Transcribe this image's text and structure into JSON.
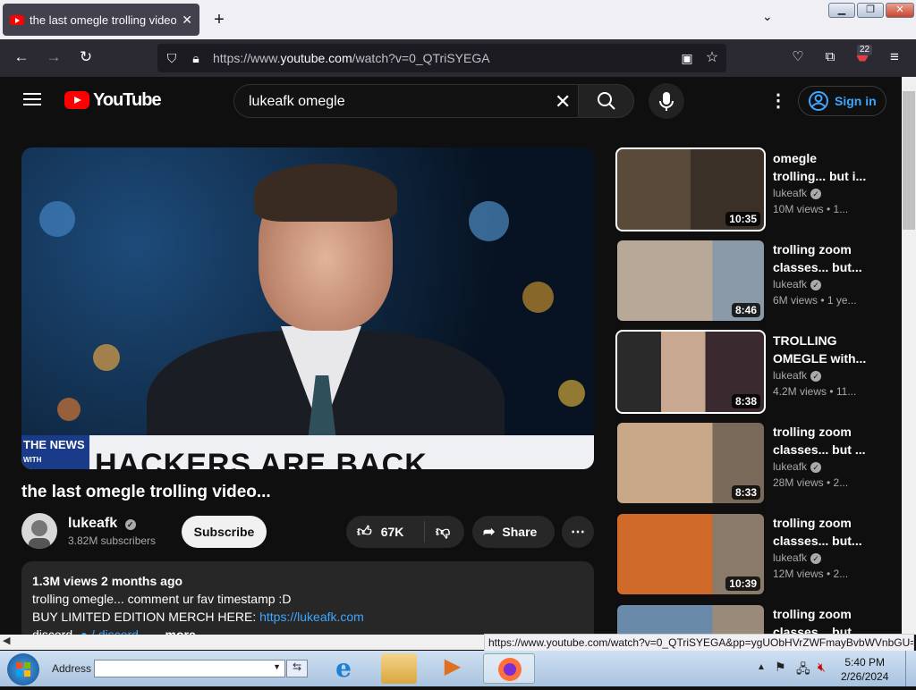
{
  "browser": {
    "tab_title": "the last omegle trolling video...",
    "new_tab": "+",
    "url_prefix": "https://www.",
    "url_domain": "youtube.com",
    "url_path": "/watch?v=0_QTriSYEGA",
    "ext_badge": "22",
    "status_url": "https://www.youtube.com/watch?v=0_QTriSYEGA&pp=ygUObHVrZWFmayBvbWVnbGU="
  },
  "youtube": {
    "logo_text": "YouTube",
    "search_value": "lukeafk omegle",
    "sign_in": "Sign in",
    "video": {
      "lower_third_small": "THE NEWS",
      "lower_third_with": "WITH",
      "lower_third_headline": "HACKERS ARE BACK",
      "title": "the last omegle trolling video...",
      "channel": "lukeafk",
      "subscribers": "3.82M subscribers",
      "subscribe": "Subscribe",
      "likes": "67K",
      "share": "Share",
      "desc_stats": "1.3M views  2 months ago",
      "desc_line1": "trolling omegle... comment ur fav timestamp :D",
      "desc_line2": "BUY LIMITED EDITION MERCH HERE: ",
      "desc_link": "https://lukeafk.com",
      "desc_line3": "discord- ",
      "desc_line3b": " / discord",
      "more": "...more"
    },
    "recommendations": [
      {
        "title": "omegle trolling... but i...",
        "channel": "lukeafk",
        "meta": "10M views  • 1...",
        "duration": "10:35"
      },
      {
        "title": "trolling zoom classes... but...",
        "channel": "lukeafk",
        "meta": "6M views  • 1 ye...",
        "duration": "8:46"
      },
      {
        "title": "TROLLING OMEGLE with...",
        "channel": "lukeafk",
        "meta": "4.2M views  • 11...",
        "duration": "8:38"
      },
      {
        "title": "trolling zoom classes... but ...",
        "channel": "lukeafk",
        "meta": "28M views  • 2...",
        "duration": "8:33"
      },
      {
        "title": "trolling zoom classes... but...",
        "channel": "lukeafk",
        "meta": "12M views  • 2...",
        "duration": "10:39"
      },
      {
        "title": "trolling zoom classes... but...",
        "channel": "",
        "meta": "",
        "duration": ""
      }
    ]
  },
  "taskbar": {
    "address_label": "Address",
    "time": "5:40 PM",
    "date": "2/26/2024"
  },
  "colors": {
    "youtube_red": "#ff0000",
    "link_blue": "#3ea6ff",
    "bg": "#0f0f0f"
  }
}
